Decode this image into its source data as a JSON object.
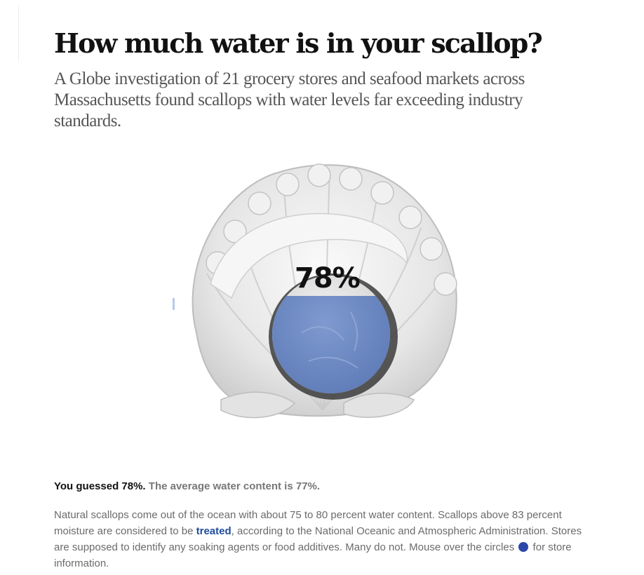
{
  "header": {
    "title": "How much water is in your scallop?",
    "dek": "A Globe investigation of 21 grocery stores and seafood markets across Massachusetts found scallops with water levels far exceeding industry standards."
  },
  "graphic": {
    "guess_display": "78%",
    "guess_value_percent": 78,
    "water_color": "#6f8cc4",
    "shell_color": "#e9e9e9",
    "icon": "scallop-shell-icon"
  },
  "result": {
    "guess_text": "You guessed 78%.",
    "average_text": "The average water content is 77%."
  },
  "body": {
    "text_before_link": "Natural scallops come out of the ocean with about 75 to 80 percent water content. Scallops above 83 percent moisture are considered to be ",
    "link_text": "treated",
    "text_after_link": ", according to the National Oceanic and Atmospheric Administration. Stores are supposed to identify any soaking agents or food additives. Many do not. Mouse over the circles ",
    "text_end": " for store information.",
    "circle_icon": "blue-circle-icon",
    "link_color": "#1f4b9c",
    "circle_color": "#2b47a7"
  }
}
